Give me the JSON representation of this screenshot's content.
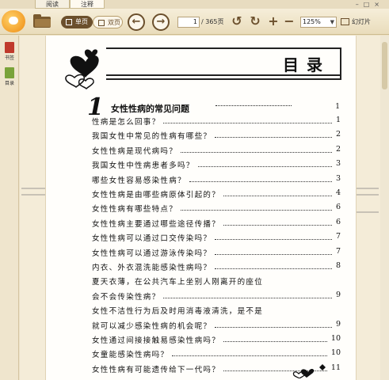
{
  "tabs": [
    "阅读",
    "注释"
  ],
  "toolbar": {
    "single_page_label": "单页",
    "double_page_label": "双页",
    "current_page": "1",
    "total_pages": "/ 365页",
    "zoom": "125%",
    "slideshow_label": "幻灯片"
  },
  "sidebar": {
    "items": [
      {
        "label": "书签",
        "icon": "bookmark-icon",
        "color": "#c0392b"
      },
      {
        "label": "目录",
        "icon": "toc-icon",
        "color": "#7aa33a"
      }
    ]
  },
  "page": {
    "title": "目录",
    "chapter": {
      "number": "1",
      "title": "女性性病的常见问题",
      "page": "1"
    },
    "entries": [
      {
        "text": "性病是怎么回事？",
        "page": "1"
      },
      {
        "text": "我国女性中常见的性病有哪些？",
        "page": "2"
      },
      {
        "text": "女性性病是现代病吗？",
        "page": "2"
      },
      {
        "text": "我国女性中性病患者多吗？",
        "page": "3"
      },
      {
        "text": "哪些女性容易感染性病？",
        "page": "3"
      },
      {
        "text": "女性性病是由哪些病原体引起的？",
        "page": "4"
      },
      {
        "text": "女性性病有哪些特点？",
        "page": "6"
      },
      {
        "text": "女性性病主要通过哪些途径传播？",
        "page": "6"
      },
      {
        "text": "女性性病可以通过口交传染吗？",
        "page": "7"
      },
      {
        "text": "女性性病可以通过游泳传染吗？",
        "page": "7"
      },
      {
        "text": "内衣、外衣混洗能感染性病吗？",
        "page": "8"
      },
      {
        "text": "夏天衣薄，在公共汽车上坐别人刚离开的座位",
        "page": ""
      },
      {
        "text": "会不会传染性病？",
        "page": "9"
      },
      {
        "text": "女性不洁性行为后及时用消毒液清洗，是不是",
        "page": ""
      },
      {
        "text": "就可以减少感染性病的机会呢？",
        "page": "9"
      },
      {
        "text": "女性通过间接接触易感染性病吗？",
        "page": "10"
      },
      {
        "text": "女童能感染性病吗？",
        "page": "10"
      },
      {
        "text": "女性性病有可能遗传给下一代吗？",
        "page": "11"
      }
    ]
  }
}
